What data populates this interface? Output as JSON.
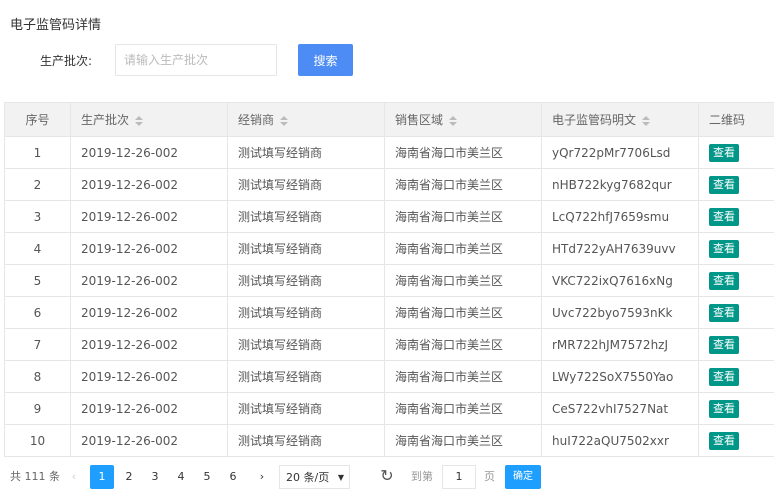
{
  "page": {
    "title": "电子监管码详情"
  },
  "search": {
    "label": "生产批次:",
    "placeholder": "请输入生产批次",
    "value": "",
    "button_label": "搜索"
  },
  "table": {
    "headers": [
      "序号",
      "生产批次",
      "经销商",
      "销售区域",
      "电子监管码明文",
      "二维码"
    ],
    "view_label": "查看",
    "rows": [
      [
        "1",
        "2019-12-26-002",
        "测试填写经销商",
        "海南省海口市美兰区",
        "yQr722pMr7706Lsd"
      ],
      [
        "2",
        "2019-12-26-002",
        "测试填写经销商",
        "海南省海口市美兰区",
        "nHB722kyg7682qur"
      ],
      [
        "3",
        "2019-12-26-002",
        "测试填写经销商",
        "海南省海口市美兰区",
        "LcQ722hfJ7659smu"
      ],
      [
        "4",
        "2019-12-26-002",
        "测试填写经销商",
        "海南省海口市美兰区",
        "HTd722yAH7639uvv"
      ],
      [
        "5",
        "2019-12-26-002",
        "测试填写经销商",
        "海南省海口市美兰区",
        "VKC722ixQ7616xNg"
      ],
      [
        "6",
        "2019-12-26-002",
        "测试填写经销商",
        "海南省海口市美兰区",
        "Uvc722byo7593nKk"
      ],
      [
        "7",
        "2019-12-26-002",
        "测试填写经销商",
        "海南省海口市美兰区",
        "rMR722hJM7572hzJ"
      ],
      [
        "8",
        "2019-12-26-002",
        "测试填写经销商",
        "海南省海口市美兰区",
        "LWy722SoX7550Yao"
      ],
      [
        "9",
        "2019-12-26-002",
        "测试填写经销商",
        "海南省海口市美兰区",
        "CeS722vhI7527Nat"
      ],
      [
        "10",
        "2019-12-26-002",
        "测试填写经销商",
        "海南省海口市美兰区",
        "huI722aQU7502xxr"
      ]
    ]
  },
  "pagination": {
    "total_text": "共 111 条",
    "pages": [
      "1",
      "2",
      "3",
      "4",
      "5",
      "6"
    ],
    "current_page": "1",
    "page_size": "20 条/页",
    "goto_label": "到第",
    "goto_value": "1",
    "page_unit": "页",
    "confirm_label": "确定"
  }
}
